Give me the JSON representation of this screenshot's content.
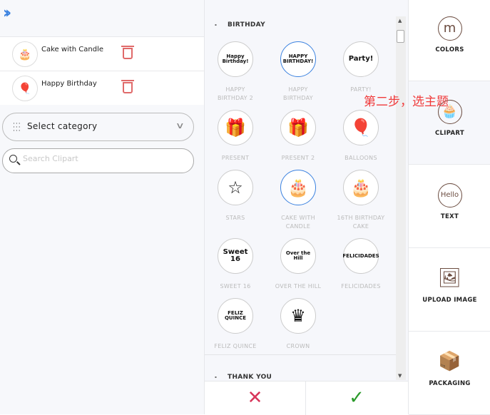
{
  "left": {
    "expand_icon": "double-chevron-right",
    "selected": [
      {
        "name": "Cake with Candle",
        "thumb": "🎂"
      },
      {
        "name": "Happy Birthday",
        "thumb": "🎈"
      }
    ],
    "category_select": {
      "value": "Select category"
    },
    "search": {
      "placeholder": "Search Clipart",
      "value": ""
    }
  },
  "middle": {
    "sections": [
      {
        "title": "BIRTHDAY",
        "items": [
          {
            "label": "HAPPY BIRTHDAY 2",
            "art": "Happy Birthday!",
            "selected": false
          },
          {
            "label": "HAPPY BIRTHDAY",
            "art": "HAPPY BIRTHDAY!",
            "selected": true
          },
          {
            "label": "PARTY!",
            "art": "Party!",
            "selected": false
          },
          {
            "label": "PRESENT",
            "art": "🎁",
            "selected": false
          },
          {
            "label": "PRESENT 2",
            "art": "🎁",
            "selected": false
          },
          {
            "label": "BALLOONS",
            "art": "🎈",
            "selected": false
          },
          {
            "label": "STARS",
            "art": "☆",
            "selected": false
          },
          {
            "label": "CAKE WITH CANDLE",
            "art": "🎂",
            "selected": true
          },
          {
            "label": "16TH BIRTHDAY CAKE",
            "art": "🎂",
            "selected": false
          },
          {
            "label": "SWEET 16",
            "art": "Sweet 16",
            "selected": false
          },
          {
            "label": "OVER THE HILL",
            "art": "Over the Hill",
            "selected": false
          },
          {
            "label": "FELICIDADES",
            "art": "FELICIDADES",
            "selected": false
          },
          {
            "label": "FELIZ QUINCE",
            "art": "FELIZ QUINCE",
            "selected": false
          },
          {
            "label": "CROWN",
            "art": "♛",
            "selected": false
          }
        ]
      },
      {
        "title": "THANK YOU",
        "items": []
      }
    ],
    "cancel_icon": "✕",
    "confirm_icon": "✓"
  },
  "right": {
    "tabs": [
      {
        "label": "COLORS",
        "icon": "m",
        "active": false
      },
      {
        "label": "CLIPART",
        "icon": "🧁",
        "active": true
      },
      {
        "label": "TEXT",
        "icon": "Hello",
        "active": false
      },
      {
        "label": "UPLOAD IMAGE",
        "icon": "🖼",
        "active": false
      },
      {
        "label": "PACKAGING",
        "icon": "📦",
        "active": false
      }
    ]
  },
  "annotation": "第二步，选主题",
  "colors": {
    "accent": "#3b82e0",
    "cancel": "#d8365a",
    "confirm": "#2a9a2a",
    "annotation": "#f03a3a",
    "trash": "#e06a6a"
  }
}
